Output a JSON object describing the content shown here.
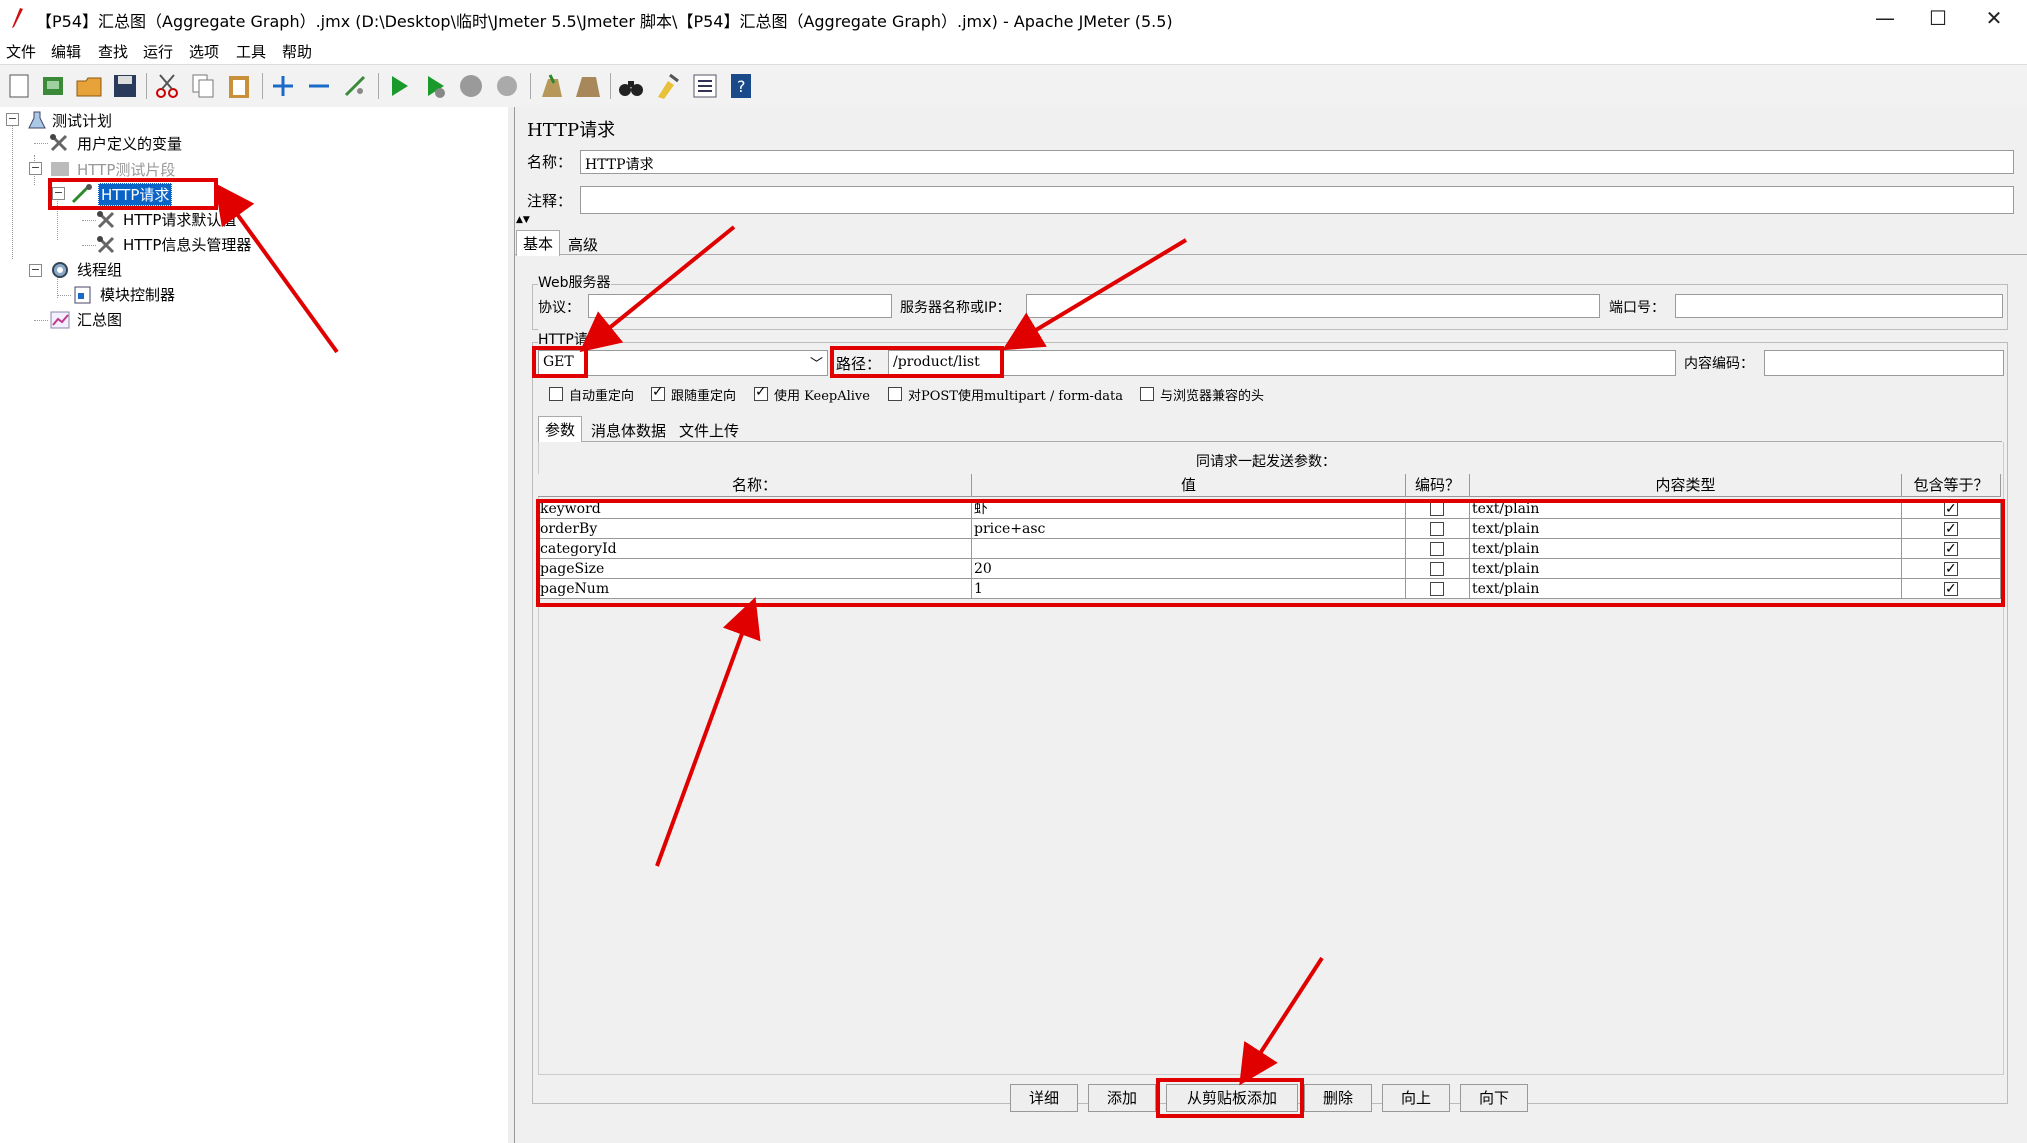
{
  "window": {
    "title": "【P54】汇总图（Aggregate Graph）.jmx (D:\\Desktop\\临时\\Jmeter 5.5\\Jmeter 脚本\\【P54】汇总图（Aggregate Graph）.jmx) - Apache JMeter (5.5)",
    "minimize": "—",
    "maximize": "☐",
    "close": "✕"
  },
  "menu": [
    "文件",
    "编辑",
    "查找",
    "运行",
    "选项",
    "工具",
    "帮助"
  ],
  "tree": {
    "test_plan": "测试计划",
    "user_vars": "用户定义的变量",
    "fragment": "HTTP测试片段",
    "http_request": "HTTP请求",
    "http_defaults": "HTTP请求默认值",
    "header_manager": "HTTP信息头管理器",
    "thread_group": "线程组",
    "module_controller": "模块控制器",
    "aggregate": "汇总图"
  },
  "panel": {
    "title": "HTTP请求",
    "name_label": "名称：",
    "name_value": "HTTP请求",
    "comment_label": "注释：",
    "comment_value": "",
    "tabs": [
      "基本",
      "高级"
    ],
    "web_server_group": "Web服务器",
    "protocol_label": "协议：",
    "server_label": "服务器名称或IP：",
    "port_label": "端口号：",
    "http_group": "HTTP请求",
    "method": "GET",
    "path_label": "路径：",
    "path_value": "/product/list",
    "encoding_label": "内容编码：",
    "checkboxes": [
      {
        "label": "自动重定向",
        "checked": false
      },
      {
        "label": "跟随重定向",
        "checked": true
      },
      {
        "label": "使用 KeepAlive",
        "checked": true
      },
      {
        "label": "对POST使用multipart / form-data",
        "checked": false
      },
      {
        "label": "与浏览器兼容的头",
        "checked": false
      }
    ],
    "subtabs": [
      "参数",
      "消息体数据",
      "文件上传"
    ],
    "params_caption": "同请求一起发送参数：",
    "columns": [
      "名称：",
      "值",
      "编码？",
      "内容类型",
      "包含等于？"
    ],
    "rows": [
      {
        "name": "keyword",
        "value": "虾",
        "encode": false,
        "type": "text/plain",
        "equals": true
      },
      {
        "name": "orderBy",
        "value": "price+asc",
        "encode": false,
        "type": "text/plain",
        "equals": true
      },
      {
        "name": "categoryId",
        "value": "",
        "encode": false,
        "type": "text/plain",
        "equals": true
      },
      {
        "name": "pageSize",
        "value": "20",
        "encode": false,
        "type": "text/plain",
        "equals": true
      },
      {
        "name": "pageNum",
        "value": "1",
        "encode": false,
        "type": "text/plain",
        "equals": true
      }
    ],
    "buttons": [
      "详细",
      "添加",
      "从剪贴板添加",
      "删除",
      "向上",
      "向下"
    ]
  },
  "colors": {
    "highlight": "#e00000",
    "selection": "#0a64c8"
  }
}
